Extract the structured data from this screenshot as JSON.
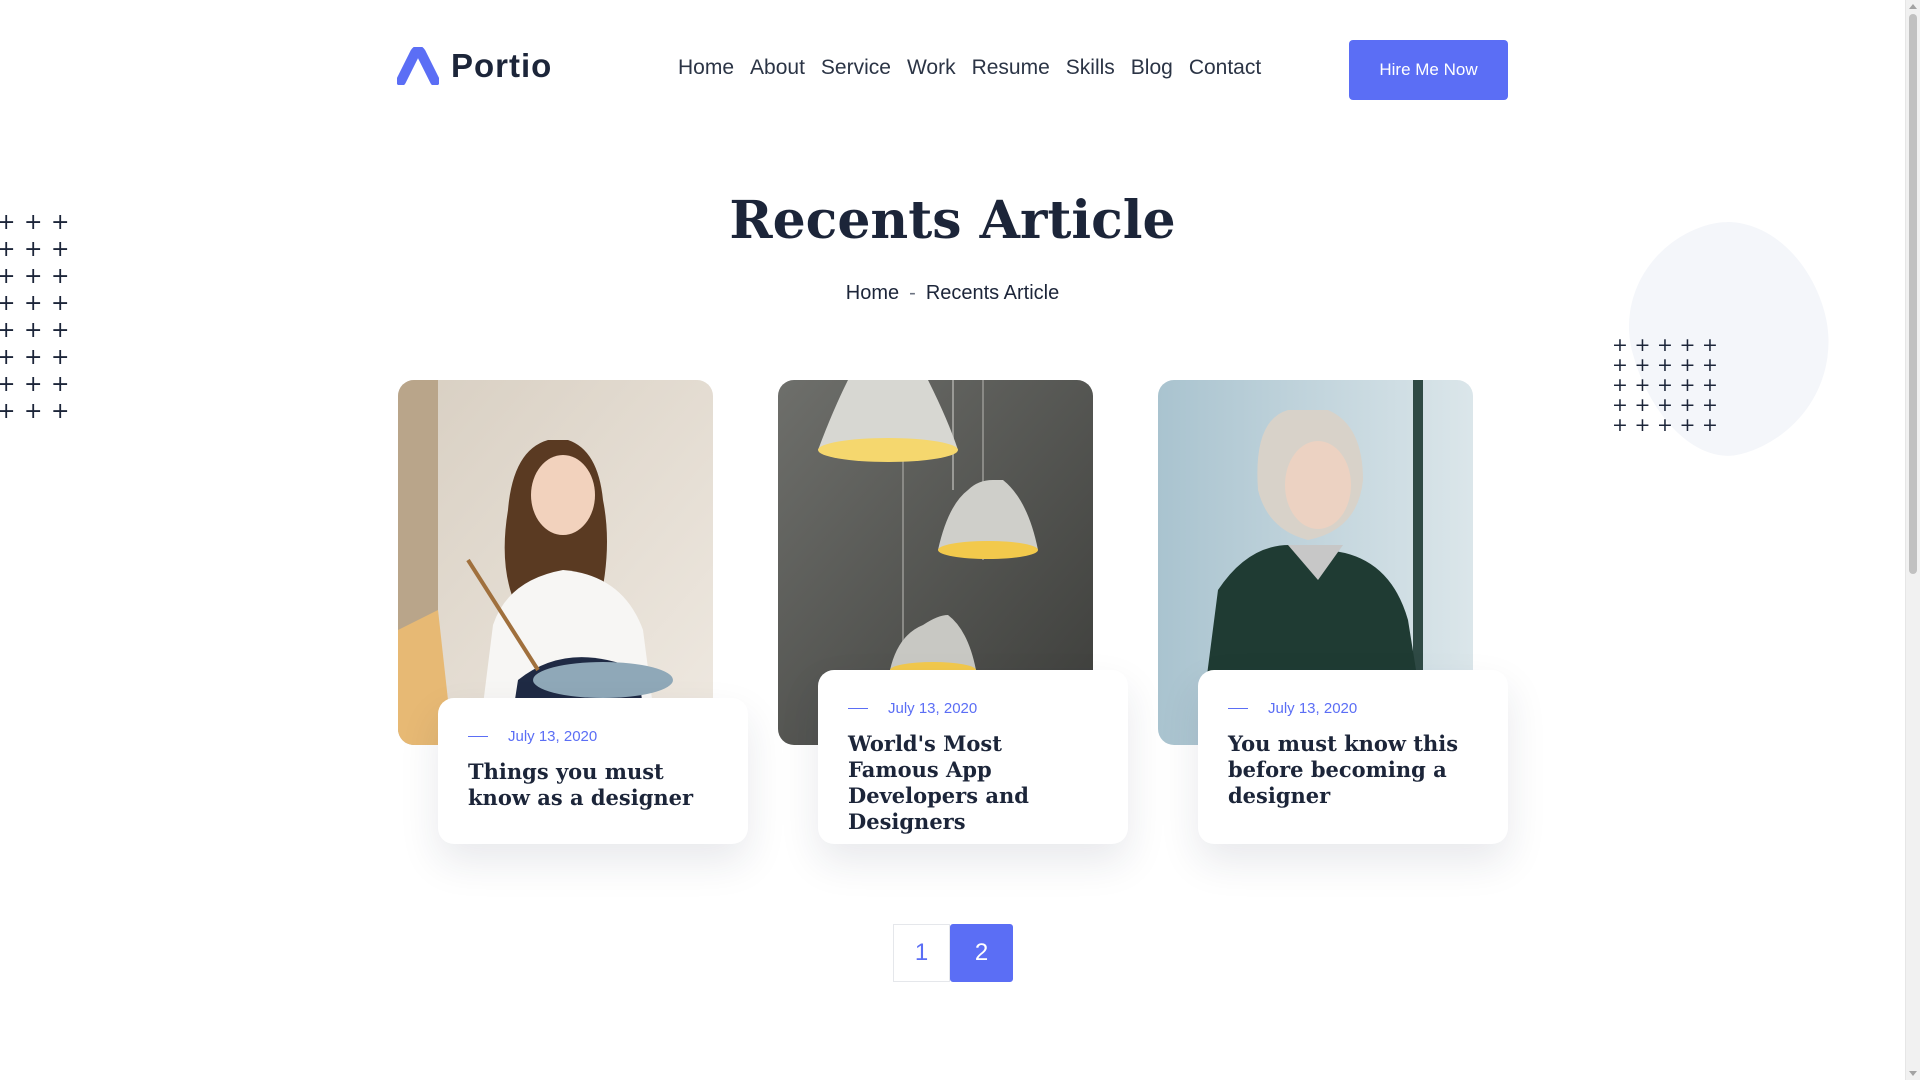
{
  "brand": {
    "name": "Portio",
    "accent": "#5b6ef5"
  },
  "nav": {
    "items": [
      "Home",
      "About",
      "Service",
      "Work",
      "Resume",
      "Skills",
      "Blog",
      "Contact"
    ]
  },
  "header": {
    "cta_label": "Hire Me Now"
  },
  "hero": {
    "title": "Recents Article",
    "breadcrumb": {
      "home": "Home",
      "separator": "-",
      "current": "Recents Article"
    }
  },
  "articles": [
    {
      "date": "July 13, 2020",
      "title": "Things you must know as a designer",
      "image": "woman-painting"
    },
    {
      "date": "July 13, 2020",
      "title": "World's Most Famous App Developers and Designers",
      "image": "pendant-lamps"
    },
    {
      "date": "July 13, 2020",
      "title": "You must know this before becoming a designer",
      "image": "woman-portrait"
    }
  ],
  "pagination": {
    "pages": [
      "1",
      "2"
    ],
    "current": "2"
  }
}
